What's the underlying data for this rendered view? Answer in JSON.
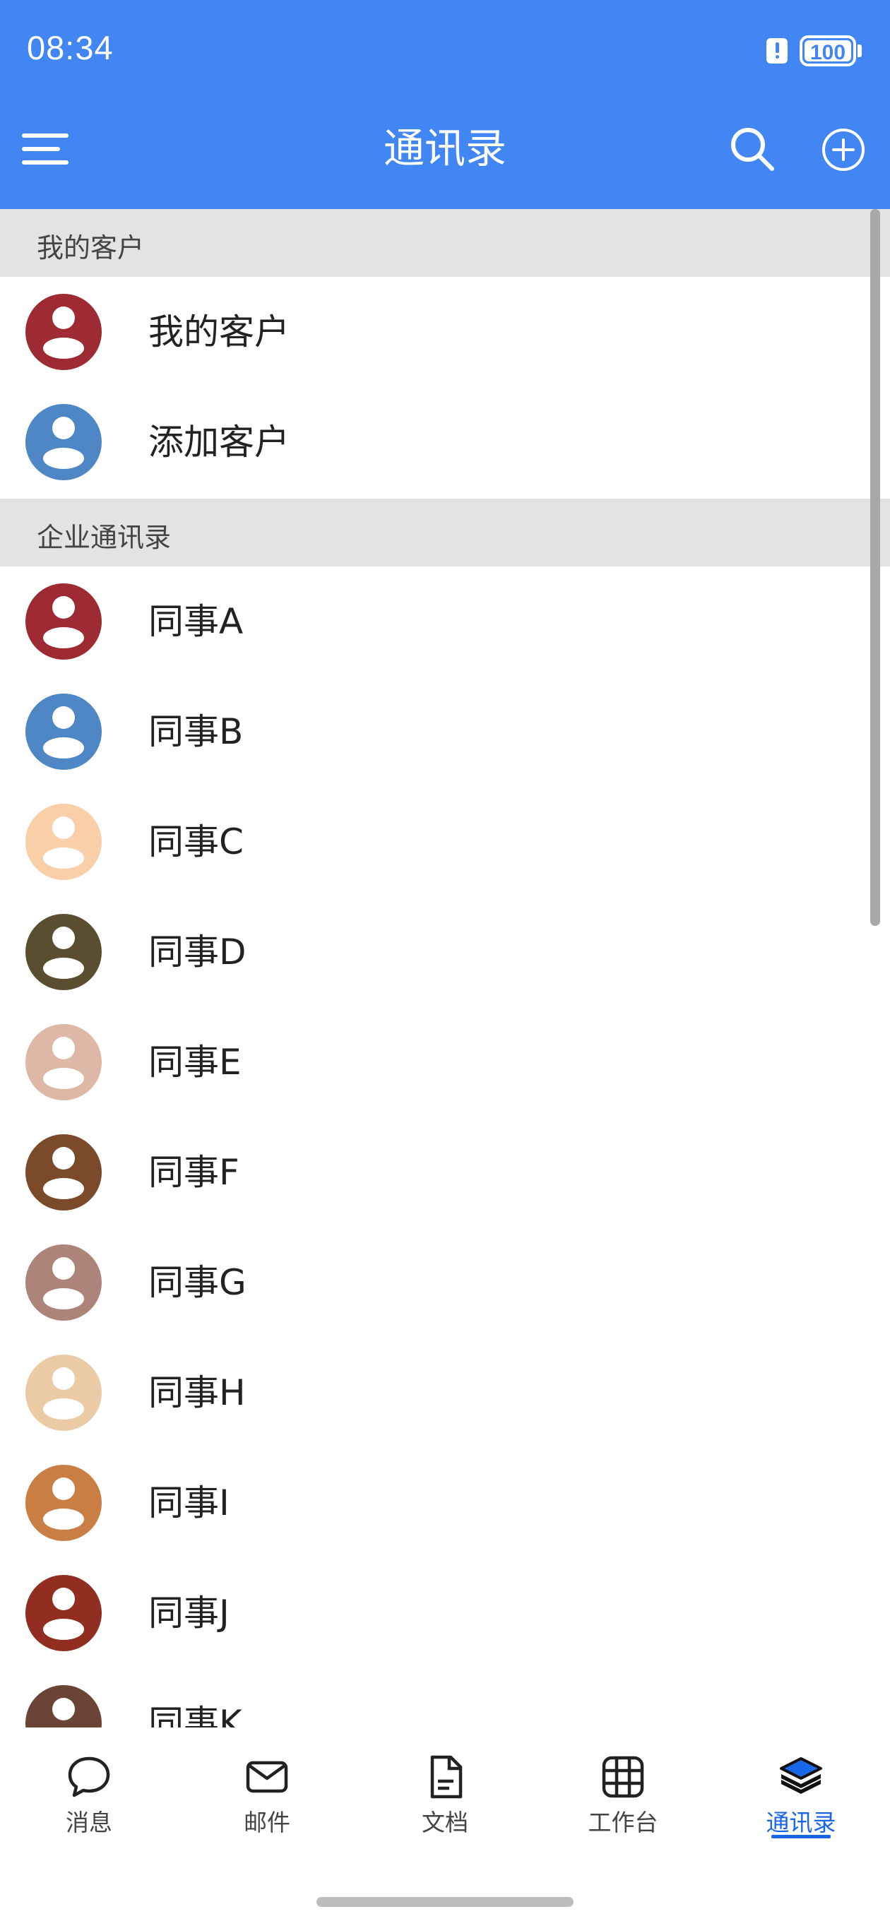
{
  "status_bar": {
    "time": "08:34",
    "battery": "100"
  },
  "header": {
    "title": "通讯录"
  },
  "sections": [
    {
      "title": "我的客户",
      "items": [
        {
          "label": "我的客户",
          "color": "#9E2A34"
        },
        {
          "label": "添加客户",
          "color": "#4E86C6"
        }
      ]
    },
    {
      "title": "企业通讯录",
      "items": [
        {
          "label": "同事A",
          "color": "#9E2A34"
        },
        {
          "label": "同事B",
          "color": "#4E86C6"
        },
        {
          "label": "同事C",
          "color": "#F8CFA9"
        },
        {
          "label": "同事D",
          "color": "#5B4D2F"
        },
        {
          "label": "同事E",
          "color": "#DDB8A6"
        },
        {
          "label": "同事F",
          "color": "#7A4A2B"
        },
        {
          "label": "同事G",
          "color": "#AD847A"
        },
        {
          "label": "同事H",
          "color": "#EACBA6"
        },
        {
          "label": "同事I",
          "color": "#C97E43"
        },
        {
          "label": "同事J",
          "color": "#922D22"
        },
        {
          "label": "同事K",
          "color": "#6B4438"
        }
      ]
    }
  ],
  "bottom_nav": [
    {
      "label": "消息",
      "icon": "chat-bubble-icon"
    },
    {
      "label": "邮件",
      "icon": "mail-icon"
    },
    {
      "label": "文档",
      "icon": "document-icon"
    },
    {
      "label": "工作台",
      "icon": "grid-icon"
    },
    {
      "label": "通讯录",
      "icon": "layers-icon",
      "active": true
    }
  ],
  "colors": {
    "header_bg": "#4286F4",
    "section_bg": "#E3E3E3",
    "active_tab": "#1A66E8"
  }
}
